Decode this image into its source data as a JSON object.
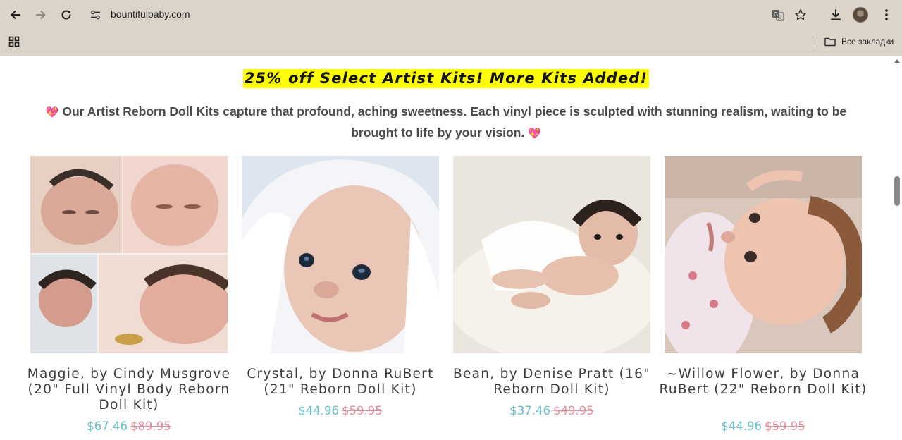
{
  "browser": {
    "url": "bountifulbaby.com",
    "bookmarks_label": "Все закладки",
    "icons": [
      "back-icon",
      "forward-icon",
      "reload-icon",
      "site-info-icon",
      "translate-icon",
      "star-icon",
      "download-icon",
      "avatar",
      "menu-icon",
      "apps-icon",
      "folder-icon"
    ]
  },
  "page": {
    "promo": "25% off Select Artist Kits! More Kits Added!",
    "intro": "Our Artist Reborn Doll Kits capture that profound, aching sweetness. Each vinyl piece is sculpted with stunning realism, waiting to be brought to life by your vision.",
    "heart_icon": "💖",
    "products": [
      {
        "title": "Maggie, by Cindy Musgrove (20\" Full Vinyl Body Reborn Doll Kit)",
        "price": "$67.46",
        "original_price": "$89.95"
      },
      {
        "title": "Crystal, by Donna RuBert (21\" Reborn Doll Kit)",
        "price": "$44.96",
        "original_price": "$59.95"
      },
      {
        "title": "Bean, by Denise Pratt (16\" Reborn Doll Kit)",
        "price": "$37.46",
        "original_price": "$49.95"
      },
      {
        "title": "~Willow Flower, by Donna RuBert (22\" Reborn Doll Kit)",
        "price": "$44.96",
        "original_price": "$59.95"
      }
    ]
  },
  "colors": {
    "promo_bg": "#ffff00",
    "price_now": "#6cc0c8",
    "price_was": "#e8909e",
    "chrome_bg": "#dcd4c8"
  }
}
